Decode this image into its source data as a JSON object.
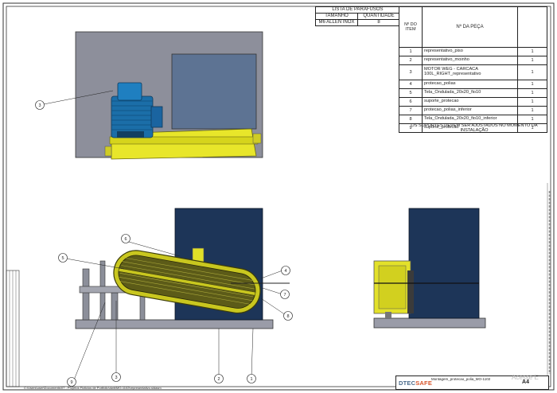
{
  "screw_list": {
    "title": "LISTA DE PARAFUSOS",
    "col_size": "TAMANHO",
    "col_qty": "QUANTIDADE",
    "rows": [
      {
        "size": "M6 ALLEN INOX",
        "qty": "8"
      }
    ]
  },
  "bom": {
    "col_item": "Nº DO\nITEM",
    "col_part": "Nº DA PEÇA",
    "rows": [
      {
        "item": "1",
        "part": "representativo_piso",
        "qty": "1"
      },
      {
        "item": "2",
        "part": "representativo_moinho",
        "qty": "1"
      },
      {
        "item": "3",
        "part": "MOTOR WEG - CARCACA 100L_RIGHT_representativo",
        "qty": "1"
      },
      {
        "item": "4",
        "part": "protecao_polias",
        "qty": "1"
      },
      {
        "item": "5",
        "part": "Tela_Ondulada_20x20_fio10",
        "qty": "1"
      },
      {
        "item": "6",
        "part": "suporte_protecao",
        "qty": "1"
      },
      {
        "item": "7",
        "part": "protecao_polias_inferior",
        "qty": "1"
      },
      {
        "item": "8",
        "part": "Tela_Ondulada_20x20_fio10_inferior",
        "qty": "1"
      },
      {
        "item": "9",
        "part": "suporte_protecao",
        "qty": "1"
      }
    ]
  },
  "note": "OS SUPORTES DEVEM SER AJUSTADOS NO MOMENTO DA INSTALAÇÃO",
  "balloons": [
    "1",
    "2",
    "3",
    "4",
    "5",
    "6",
    "7",
    "8",
    "9",
    "3"
  ],
  "title_block": {
    "logo_left": "DTEC",
    "logo_right": "SAFE",
    "drawing_title": "Montagem_protecao_polia_MO-1102",
    "sheet_size": "A4"
  },
  "file_path": "C:\\Users\\user\\Documents\\07 - Projetos Ficticios de Portfolio\\dwb\\MO-1102\\representativo.sldasm",
  "watermark": "Acesse E",
  "colors": {
    "wall": "#8d8f9b",
    "hopper": "#1d3558",
    "yellow": "#e8e62a",
    "motor_blue": "#1b6ea8",
    "floor": "#9a9ca8"
  }
}
